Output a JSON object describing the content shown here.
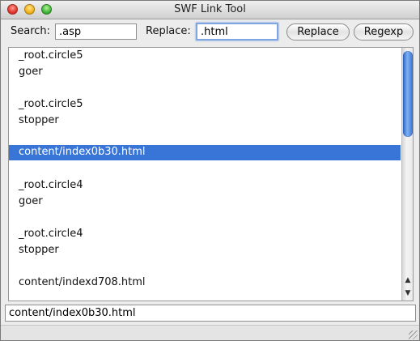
{
  "window": {
    "title": "SWF Link Tool"
  },
  "toolbar": {
    "search_label": "Search:",
    "search_value": ".asp",
    "replace_label": "Replace:",
    "replace_value": ".html",
    "replace_button_label": "Replace",
    "regexp_button_label": "Regexp"
  },
  "list": {
    "items": [
      {
        "line1": "_root.circle5",
        "line2": "goer"
      },
      {
        "line1": "_root.circle5",
        "line2": "stopper"
      },
      {
        "line1": "content/index0b30.html",
        "line2": "",
        "selected": true
      },
      {
        "line1": "_root.circle4",
        "line2": "goer"
      },
      {
        "line1": "_root.circle4",
        "line2": "stopper"
      },
      {
        "line1": "content/indexd708.html",
        "line2": ""
      }
    ]
  },
  "scrollbar": {
    "up_arrow": "▲",
    "down_arrow": "▼"
  },
  "status": {
    "value": "content/index0b30.html"
  },
  "colors": {
    "selection": "#3875d7",
    "focus_ring": "#7fa6e0"
  }
}
